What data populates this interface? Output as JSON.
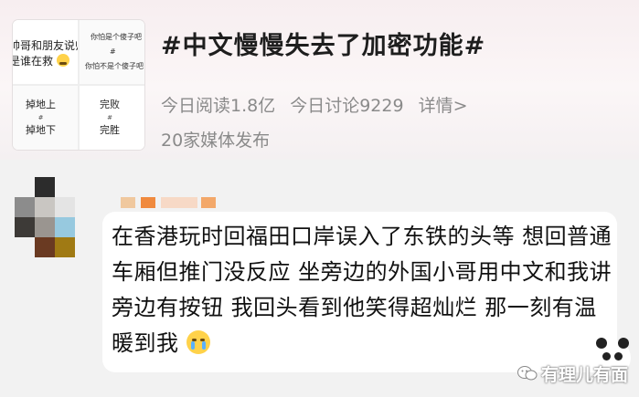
{
  "topic": {
    "title": "#中文慢慢失去了加密功能#",
    "reads": "今日阅读1.8亿",
    "discussions": "今日讨论9229",
    "details": "详情>",
    "media": "20家媒体发布"
  },
  "thumbnail": {
    "q1_line1": "帅哥和朋友说帅",
    "q1_line2": "是谁在救",
    "q2_line1": "你怕是个傻子吧",
    "q2_mid": "#",
    "q2_line2": "你怕不是个傻子吧",
    "q3_line1": "掉地上",
    "q3_mid": "#",
    "q3_line2": "掉地下",
    "q4_line1": "完败",
    "q4_mid": "#",
    "q4_line2": "完胜"
  },
  "comment": {
    "text": "在香港玩时回福田口岸误入了东铁的头等 想回普通车厢但推门没反应 坐旁边的外国小哥用中文和我讲旁边有按钮 我回头看到他笑得超灿烂 那一刻有温暖到我",
    "emoji_icon": "crying-face-icon"
  },
  "watermark": {
    "text": "有理儿有面",
    "icon": "wechat-icon"
  },
  "colors": {
    "title": "#1e1e1e",
    "meta": "#8a8a8a",
    "comment_bubble": "#ffffff",
    "page_bg": "#f2f2f2"
  }
}
